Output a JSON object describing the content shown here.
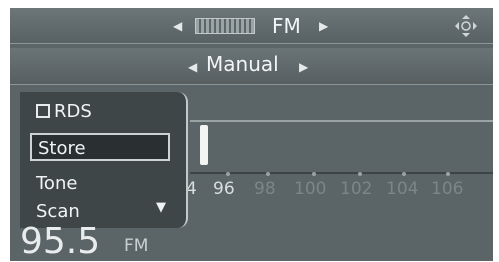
{
  "header": {
    "band": "FM",
    "band_icon": "radio-band-icon",
    "nav_icon": "directional-pad-icon"
  },
  "mode": {
    "label": "Manual"
  },
  "menu": {
    "items": [
      {
        "label": "RDS",
        "checkbox": true,
        "checked": false
      },
      {
        "label": "Store",
        "selected": true
      },
      {
        "label": "Tone"
      },
      {
        "label": "Scan"
      }
    ]
  },
  "tuner": {
    "frequency": "95.5",
    "unit": "FM",
    "scale": [
      "4",
      "96",
      "98",
      "100",
      "102",
      "104",
      "106"
    ]
  },
  "colors": {
    "background": "#5b6466",
    "text": "#f2f5f5",
    "highlight": "#cdd3d4"
  }
}
